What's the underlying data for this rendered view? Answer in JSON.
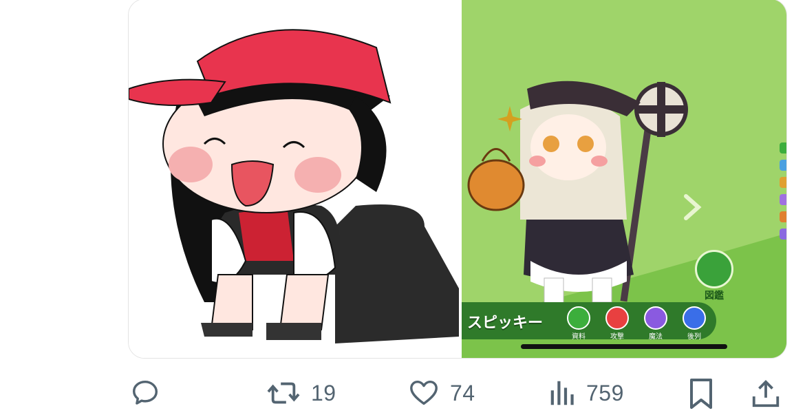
{
  "actions": {
    "reply_icon": "speech-bubble-icon",
    "retweet_count": "19",
    "like_count": "74",
    "views_count": "759"
  },
  "game": {
    "character_name": "スピッキー",
    "buttons": [
      {
        "label": "資料",
        "color": "#3cae3c"
      },
      {
        "label": "攻撃",
        "color": "#e84040"
      },
      {
        "label": "魔法",
        "color": "#8a5ae0"
      },
      {
        "label": "後列",
        "color": "#3a6ee8"
      }
    ],
    "encyclopedia_label": "図鑑"
  },
  "colors": {
    "action_gray": "#536471",
    "game_bg": "#9fd46a",
    "cap_red": "#e8344e"
  }
}
